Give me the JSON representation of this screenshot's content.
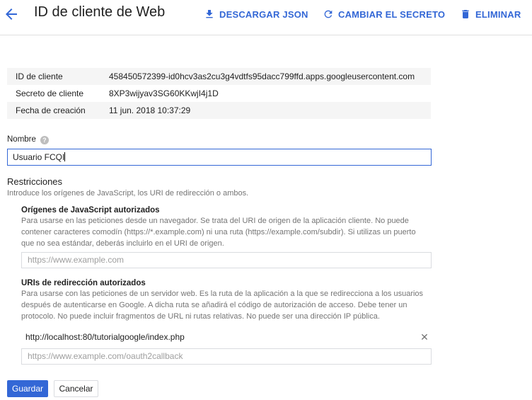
{
  "header": {
    "title": "ID de cliente de Web",
    "actions": [
      {
        "label": "DESCARGAR JSON",
        "icon": "download-icon"
      },
      {
        "label": "CAMBIAR EL SECRETO",
        "icon": "refresh-icon"
      },
      {
        "label": "ELIMINAR",
        "icon": "trash-icon"
      }
    ],
    "accent_color": "#3367d6"
  },
  "client_info": [
    {
      "key": "ID de cliente",
      "value": "458450572399-id0hcv3as2cu3g4vdtfs95dacc799ffd.apps.googleusercontent.com"
    },
    {
      "key": "Secreto de cliente",
      "value": "8XP3wijyav3SG60KKwjI4j1D"
    },
    {
      "key": "Fecha de creación",
      "value": "11 jun. 2018 10:37:29"
    }
  ],
  "name_field": {
    "label": "Nombre",
    "value": "Usuario FCQI"
  },
  "restrictions": {
    "title": "Restricciones",
    "description": "Introduce los orígenes de JavaScript, los URI de redirección o ambos.",
    "js_origins": {
      "title": "Orígenes de JavaScript autorizados",
      "desc_lines": [
        "Para usarse en las peticiones desde un navegador. Se trata del URI de origen de la aplicación cliente. No puede",
        "contener caracteres comodín (https://*.example.com) ni una ruta (https://example.com/subdir). Si utilizas un puerto",
        "que no sea estándar, deberás incluirlo en el URI de origen."
      ],
      "placeholder": "https://www.example.com"
    },
    "redirect_uris": {
      "title": "URIs de redirección autorizados",
      "desc_lines": [
        "Para usarse con las peticiones de un servidor web. Es la ruta de la aplicación a la que se redirecciona a los usuarios",
        "después de autenticarse en Google. A dicha ruta se añadirá el código de autorización de acceso. Debe tener un",
        "protocolo. No puede incluir fragmentos de URL ni rutas relativas. No puede ser una dirección IP pública."
      ],
      "entries": [
        "http://localhost:80/tutorialgoogle/index.php"
      ],
      "placeholder": "https://www.example.com/oauth2callback"
    }
  },
  "buttons": {
    "save": "Guardar",
    "cancel": "Cancelar"
  }
}
